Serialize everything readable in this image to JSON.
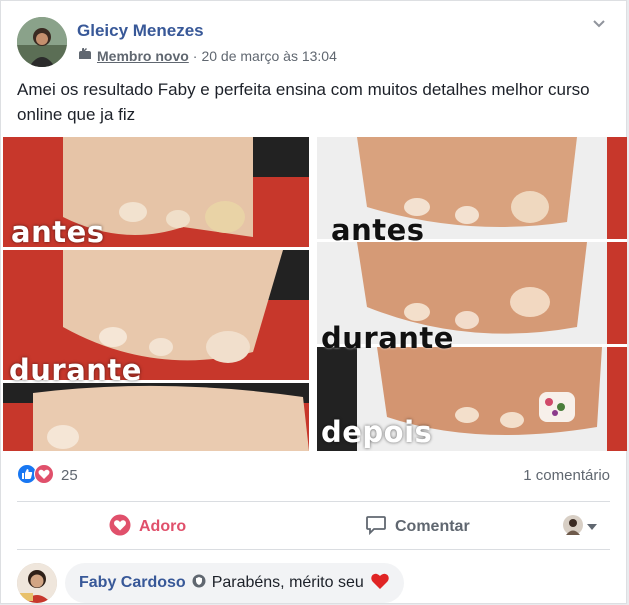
{
  "post": {
    "author": "Gleicy Menezes",
    "badge": "Membro novo",
    "separator": "·",
    "date": "20 de março às 13:04",
    "text": "Amei os resultado Faby e perfeita ensina com muitos detalhes melhor curso online que ja fiz"
  },
  "photo_labels": {
    "left_top": "antes",
    "left_mid": "durante",
    "right_top": "antes",
    "right_mid": "durante",
    "right_bottom": "depois"
  },
  "stats": {
    "reaction_count": "25",
    "comment_count": "1 comentário"
  },
  "actions": {
    "love": "Adoro",
    "comment": "Comentar"
  },
  "comment": {
    "author": "Faby Cardoso",
    "text": "Parabéns, mérito seu"
  },
  "colors": {
    "link_blue": "#385898",
    "love_red": "#e0506b",
    "like_blue": "#1877f2"
  },
  "icons": [
    "avatar",
    "member-badge-icon",
    "chevron-down-icon",
    "like-reaction-icon",
    "love-reaction-icon",
    "love-action-icon",
    "comment-icon",
    "audience-avatar",
    "dropdown-caret-icon",
    "shield-badge-icon",
    "heart-emoji-icon"
  ]
}
